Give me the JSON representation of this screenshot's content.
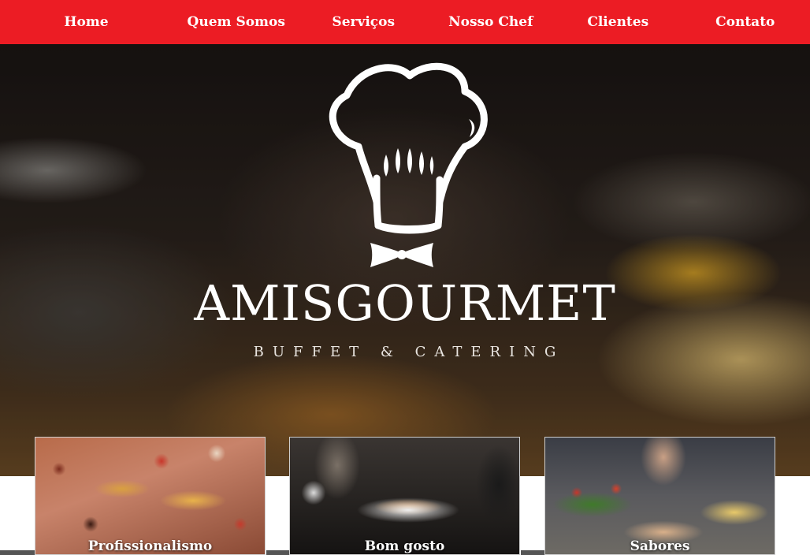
{
  "nav": {
    "items": [
      {
        "label": "Home"
      },
      {
        "label": "Quem Somos"
      },
      {
        "label": "Serviços"
      },
      {
        "label": "Nosso Chef"
      },
      {
        "label": "Clientes"
      },
      {
        "label": "Contato"
      }
    ]
  },
  "hero": {
    "brand": "AMISGOURMET",
    "tagline": "BUFFET & CATERING",
    "logo_icon": "chef-hat-icon",
    "bowtie_icon": "bow-tie-icon"
  },
  "cards": [
    {
      "label": "Profissionalismo"
    },
    {
      "label": "Bom gosto"
    },
    {
      "label": "Sabores"
    }
  ],
  "colors": {
    "nav_bg": "#ec1c24",
    "nav_text": "#ffffff",
    "brand_text": "#ffffff"
  }
}
